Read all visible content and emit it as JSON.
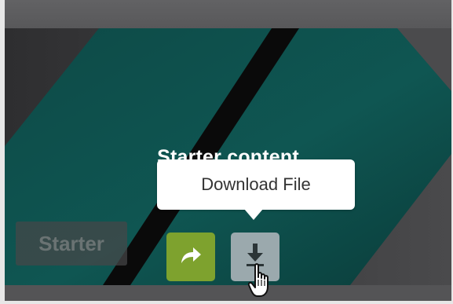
{
  "thumbnail": {
    "title": "Starter content",
    "badge": "Starter"
  },
  "tooltip": {
    "text": "Download File"
  },
  "actions": {
    "share_icon": "share-arrow-icon",
    "download_icon": "download-icon"
  },
  "colors": {
    "teal": "#0f4f4b",
    "share_green": "#7ea22e",
    "download_gray": "#9ba9ad"
  }
}
